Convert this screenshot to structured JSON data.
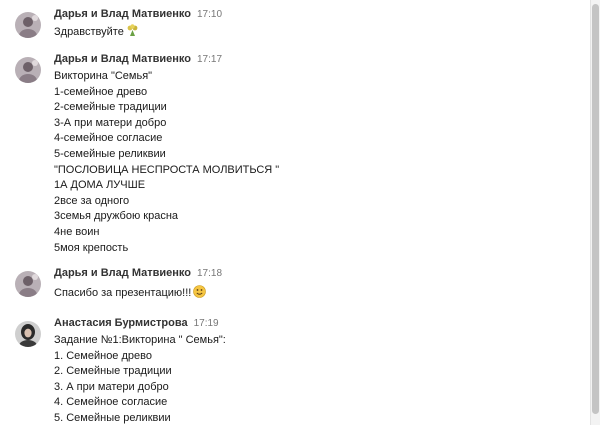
{
  "messages": [
    {
      "author": "Дарья и Влад Матвиенко",
      "time": "17:10",
      "lines": [
        "Здравствуйте"
      ],
      "emoji": "flower-bouquet-icon"
    },
    {
      "author": "Дарья и Влад Матвиенко",
      "time": "17:17",
      "lines": [
        "Викторина \"Семья\"",
        "1-семейное древо",
        "2-семейные традиции",
        "3-А при матери добро",
        "4-семейное согласие",
        "5-семейные реликвии",
        "\"ПОСЛОВИЦА НЕСПРОСТА МОЛВИТЬСЯ \"",
        "1А ДОМА ЛУЧШЕ",
        "2все за одного",
        "3семья дружбою красна",
        "4не воин",
        "5моя крепость"
      ]
    },
    {
      "author": "Дарья и Влад Матвиенко",
      "time": "17:18",
      "lines": [
        "Спасибо за презентацию!!!"
      ],
      "emoji": "smiling-face-icon"
    },
    {
      "author": "Анастасия Бурмистрова",
      "time": "17:19",
      "lines": [
        "Задание №1:Викторина \" Семья\":",
        "1. Семейное древо",
        "2. Семейные традиции",
        "3. А при матери добро",
        "4. Семейное согласие",
        "5. Семейные реликвии"
      ]
    }
  ]
}
